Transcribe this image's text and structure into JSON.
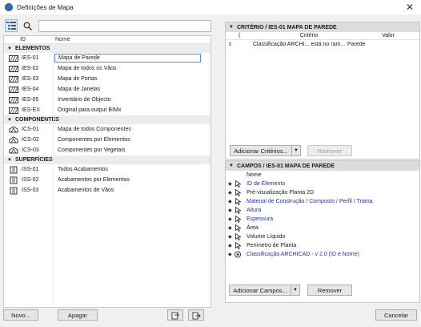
{
  "window": {
    "title": "Definições de Mapa"
  },
  "left": {
    "header": {
      "id": "ID",
      "name": "Nome"
    },
    "groups": [
      {
        "label": "ELEMENTOS",
        "rows": [
          {
            "id": "IES-01",
            "name": "Mapa de Parede",
            "selected": true
          },
          {
            "id": "IES-02",
            "name": "Mapa de todos os Vãos"
          },
          {
            "id": "IES-03",
            "name": "Mapa de Portas"
          },
          {
            "id": "IES-04",
            "name": "Mapa de Janelas"
          },
          {
            "id": "IES-05",
            "name": "Inventário de Objecto"
          },
          {
            "id": "IES-EX",
            "name": "Original para output BIMx"
          }
        ]
      },
      {
        "label": "COMPONENTES",
        "rows": [
          {
            "id": "ICS-01",
            "name": "Mapa de todos Componentes"
          },
          {
            "id": "ICS-02",
            "name": "Componentes por Elementos"
          },
          {
            "id": "ICS-03",
            "name": "Componentes por Vegetais"
          }
        ]
      },
      {
        "label": "SUPERFÍCIES",
        "rows": [
          {
            "id": "ISS-01",
            "name": "Todos Acabamentos"
          },
          {
            "id": "ISS-02",
            "name": "Acabamentos por Elementos"
          },
          {
            "id": "ISS-03",
            "name": "Acabamentos de Vãos"
          }
        ]
      }
    ],
    "buttons": {
      "new": "Novo...",
      "delete": "Apagar"
    }
  },
  "criteria": {
    "title": "CRITÉRIO / IES-01 MAPA DE PAREDE",
    "columns": {
      "paren": "(",
      "criterion": "Critério",
      "value": "Valor"
    },
    "rows": [
      {
        "criterion": "Classificação ARCHI... está no ram...",
        "value": "Parede"
      }
    ],
    "add_button": "Adicionar Critérios...",
    "remove_button": "Remover"
  },
  "fields": {
    "title": "CAMPOS / IES-01 MAPA DE PAREDE",
    "column": "Nome",
    "rows": [
      {
        "name": "ID de Elemento",
        "blue": true
      },
      {
        "name": "Pré-visualização Planta 2D",
        "blue": false
      },
      {
        "name": "Material de Construção / Composto / Perfil / Trama",
        "blue": true
      },
      {
        "name": "Altura",
        "blue": true
      },
      {
        "name": "Espessura",
        "blue": true
      },
      {
        "name": "Área",
        "blue": false
      },
      {
        "name": "Volume Líquido",
        "blue": false
      },
      {
        "name": "Perímetro de Planta",
        "blue": false
      },
      {
        "name": "Classificação ARCHICAD - v 2.0 (ID e Nome)",
        "blue": true,
        "icon": "classification"
      }
    ],
    "add_button": "Adicionar Campos...",
    "remove_button": "Remover"
  },
  "footer": {
    "cancel": "Cancelar"
  }
}
